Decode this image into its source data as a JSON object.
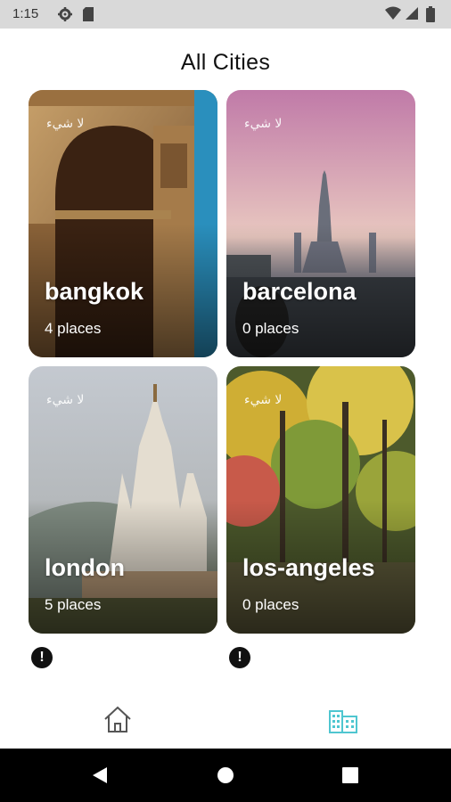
{
  "status_bar": {
    "time": "1:15",
    "icons": [
      "gear-icon",
      "sd-card-icon",
      "wifi-icon",
      "signal-icon",
      "battery-icon"
    ]
  },
  "page": {
    "title": "All Cities"
  },
  "cities": [
    {
      "name": "bangkok",
      "places": "4 places",
      "arabic": "لا شيء",
      "theme": "arch",
      "colors": [
        "#5a3a20",
        "#c0955f",
        "#2a8fbd"
      ]
    },
    {
      "name": "barcelona",
      "places": "0 places",
      "arabic": "لا شيء",
      "theme": "temple",
      "colors": [
        "#c788b3",
        "#e8c2b8",
        "#4a5058"
      ]
    },
    {
      "name": "london",
      "places": "5 places",
      "arabic": "لا شيء",
      "theme": "church",
      "colors": [
        "#c9ccd2",
        "#d8cab9",
        "#6a6c50"
      ]
    },
    {
      "name": "los-angeles",
      "places": "0 places",
      "arabic": "لا شيء",
      "theme": "forest",
      "colors": [
        "#d8b93a",
        "#5e7a2c",
        "#3a3524"
      ]
    }
  ],
  "warnings": [
    {
      "symbol": "!",
      "icon": "error-icon"
    },
    {
      "symbol": "!",
      "icon": "error-icon"
    }
  ],
  "bottom_nav": {
    "items": [
      {
        "icon": "home-icon",
        "active": false
      },
      {
        "icon": "city-buildings-icon",
        "active": true
      }
    ],
    "active_color": "#4fc6d0",
    "inactive_color": "#555555"
  },
  "system_nav": {
    "icons": [
      "back-icon",
      "home-circle-icon",
      "recents-icon"
    ]
  }
}
